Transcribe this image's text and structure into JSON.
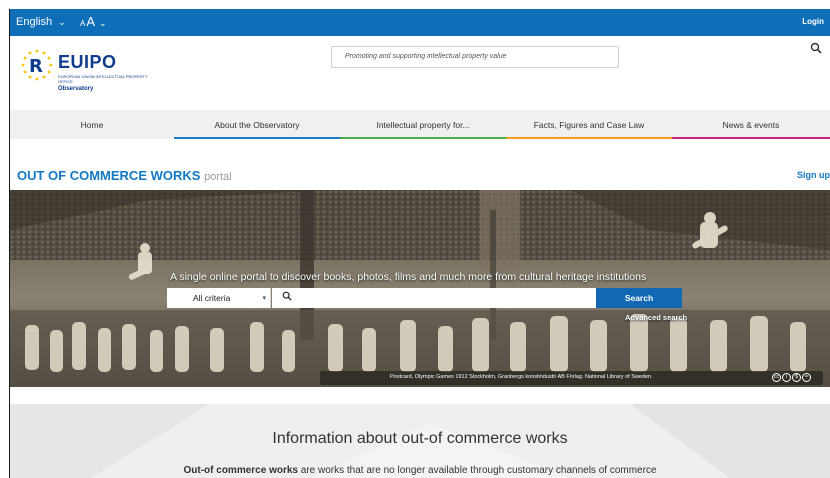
{
  "topbar": {
    "language": "English",
    "font_small": "A",
    "font_large": "A",
    "login": "Login"
  },
  "header": {
    "logo_name": "EUIPO",
    "logo_sub": "European Union Intellectual Property Office",
    "logo_observatory": "Observatory",
    "tagline": "Promoting and supporting intellectual property value",
    "search_icon": "search-icon"
  },
  "nav": {
    "items": [
      {
        "label": "Home",
        "color": "#8a8a8a"
      },
      {
        "label": "About the Observatory",
        "color": "#1c7bc6"
      },
      {
        "label": "Intellectual property for...",
        "color": "#4aae50"
      },
      {
        "label": "Facts, Figures and Case Law",
        "color": "#f29b1c"
      },
      {
        "label": "News & events",
        "color": "#c8247f"
      }
    ]
  },
  "portal": {
    "title": "OUT OF COMMERCE WORKS",
    "title_suffix": "portal",
    "signup": "Sign up"
  },
  "hero": {
    "headline": "A single online portal to discover books, photos, films and much more from cultural heritage institutions",
    "criteria_value": "All criteria",
    "search_placeholder": "",
    "search_button": "Search",
    "advanced_search": "Advanced search",
    "caption": "Postcard, Olympic Games 1912 Stockholm, Granbergs konstindustri AB Förlag. National Library of Sweden."
  },
  "info": {
    "title": "Information about out-of commerce works",
    "text_bold": "Out-of commerce works",
    "text_rest": " are works that are no longer available through customary channels of commerce"
  },
  "colors": {
    "topbar": "#0f6eb8",
    "brand_blue": "#1379c4",
    "search_button": "#1069b2"
  }
}
